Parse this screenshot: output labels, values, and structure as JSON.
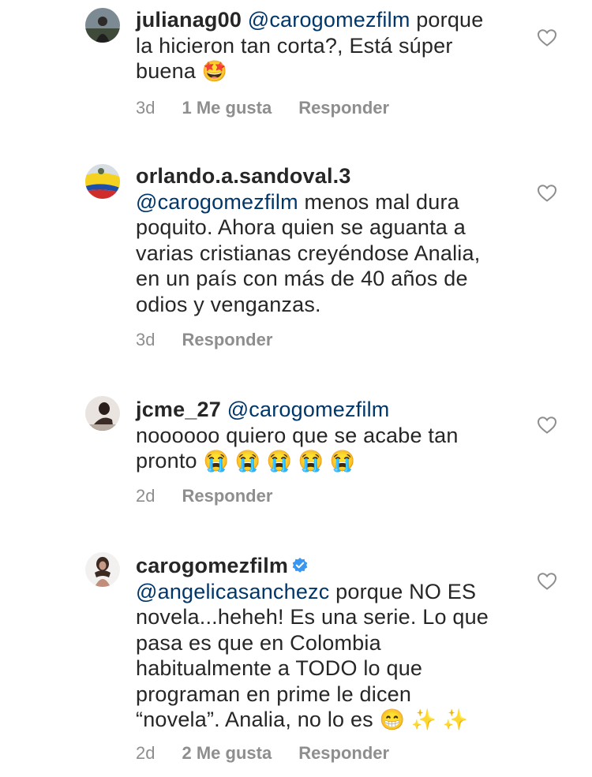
{
  "comments": [
    {
      "username": "julianag00",
      "mention": "@carogomezfilm",
      "text_line1": " porque",
      "text_line2": "la hicieron tan corta?, Está súper",
      "text_line3": "buena ",
      "emoji": "🤩",
      "time": "3d",
      "likes": "1 Me gusta",
      "reply_label": "Responder",
      "avatar_icon": "profile-photo",
      "like_icon": "heart-outline-icon"
    },
    {
      "username": "orlando.a.sandoval.3",
      "mention": "@carogomezfilm",
      "text_line1": " menos mal dura",
      "text_line2": "poquito. Ahora quien se aguanta a",
      "text_line3": "varias cristianas creyéndose Analia,",
      "text_line4": "en un país con más de 40 años de",
      "text_line5": "odios y venganzas.",
      "time": "3d",
      "reply_label": "Responder",
      "avatar_icon": "colombia-flag-avatar",
      "like_icon": "heart-outline-icon"
    },
    {
      "username": "jcme_27",
      "mention": "@carogomezfilm",
      "text_line1": "noooooo quiero que se acabe tan",
      "text_line2": "pronto ",
      "emoji": "😭 😭 😭 😭 😭",
      "time": "2d",
      "reply_label": "Responder",
      "avatar_icon": "profile-photo",
      "like_icon": "heart-outline-icon"
    },
    {
      "username": "carogomezfilm",
      "verified_icon": "verified-badge-icon",
      "mention": "@angelicasanchezc",
      "text_line1": " porque NO ES",
      "text_line2": "novela...heheh! Es una serie. Lo que",
      "text_line3": "pasa es que en Colombia",
      "text_line4": "habitualmente a TODO lo que",
      "text_line5": "programan en prime le dicen",
      "text_line6": "“novela”. Analia, no lo es ",
      "emoji": "😁 ✨ ✨",
      "time": "2d",
      "likes": "2 Me gusta",
      "reply_label": "Responder",
      "avatar_icon": "profile-photo",
      "like_icon": "heart-outline-icon"
    }
  ]
}
